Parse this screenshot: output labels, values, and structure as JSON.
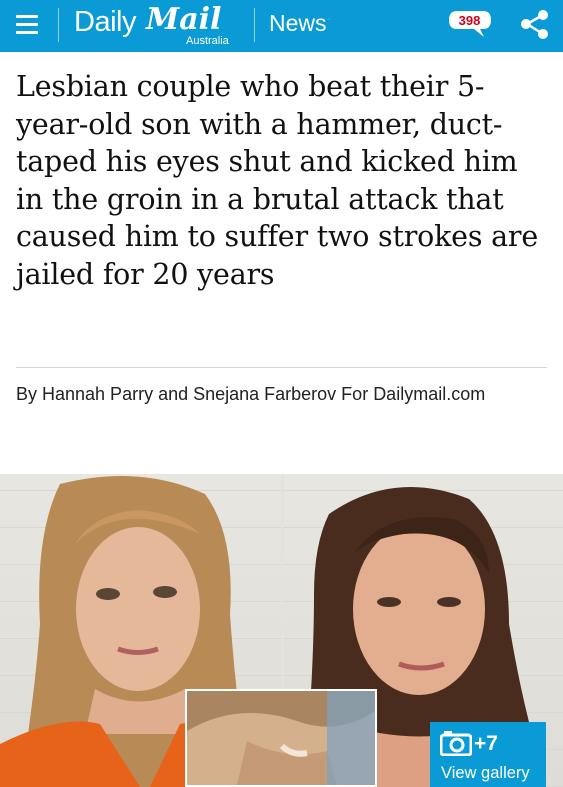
{
  "header": {
    "brand_daily": "Daily",
    "brand_mail": "Mail",
    "brand_region": "Australia",
    "section": "News",
    "comment_count": "398",
    "menu_icon": "hamburger-menu-icon",
    "share_icon": "share-icon",
    "background_color": "#0a9bd6"
  },
  "article": {
    "headline": "Lesbian couple who beat their 5-year-old son with a hammer, duct-taped his eyes shut and kicked him in the groin in a brutal attack that caused him to suffer two strokes are jailed for 20 years",
    "byline": "By Hannah Parry and Snejana Farberov For Dailymail.com"
  },
  "gallery": {
    "count": "+7",
    "label": "View gallery",
    "icon": "camera-icon"
  }
}
